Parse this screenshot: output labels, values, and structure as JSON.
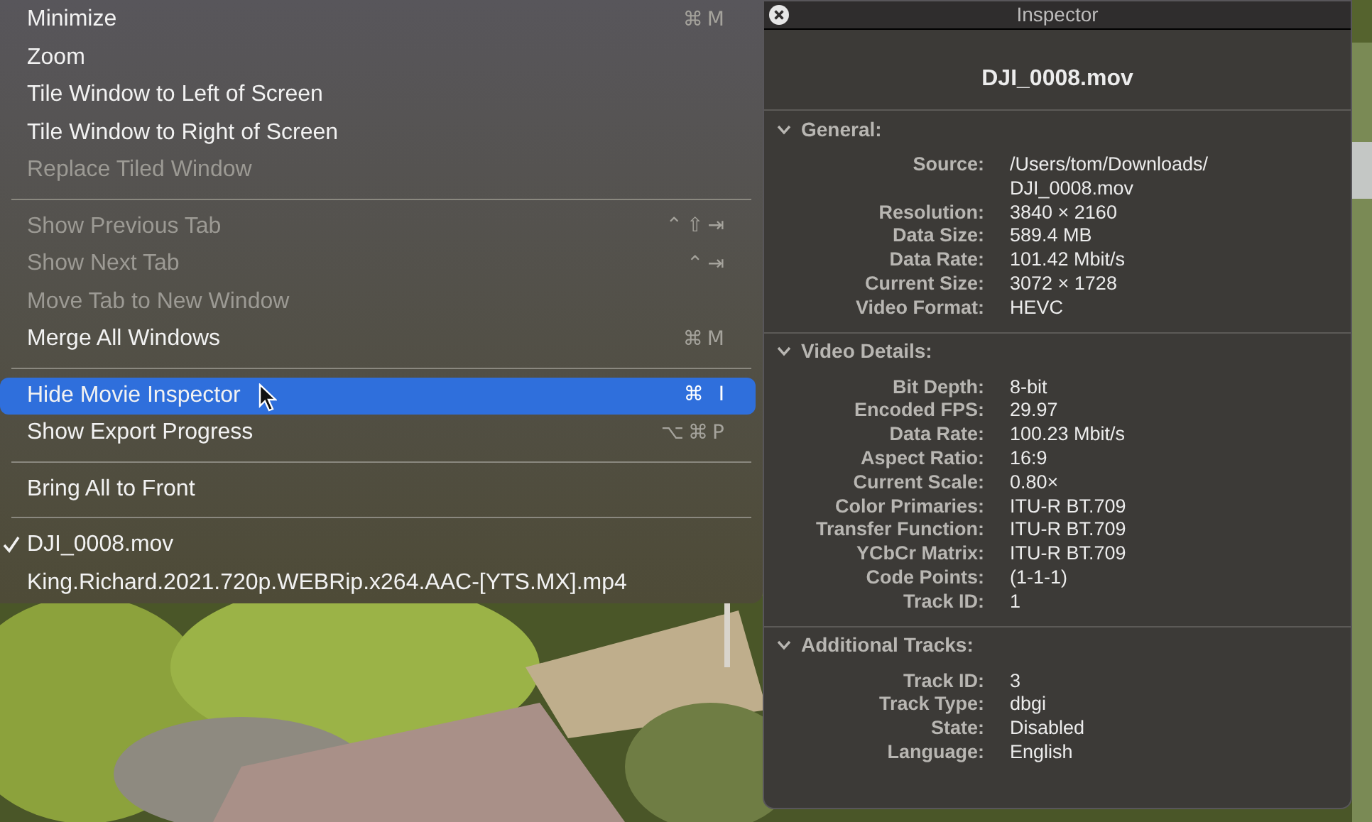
{
  "menu": {
    "sections": [
      [
        {
          "label": "Minimize",
          "shortcut": "⌘M",
          "disabled": false,
          "selected": false,
          "checked": false
        },
        {
          "label": "Zoom",
          "disabled": false,
          "selected": false,
          "checked": false
        },
        {
          "label": "Tile Window to Left of Screen",
          "disabled": false,
          "selected": false,
          "checked": false
        },
        {
          "label": "Tile Window to Right of Screen",
          "disabled": false,
          "selected": false,
          "checked": false
        },
        {
          "label": "Replace Tiled Window",
          "disabled": true,
          "selected": false,
          "checked": false
        }
      ],
      [
        {
          "label": "Show Previous Tab",
          "shortcut": "⌃⇧⇥",
          "disabled": true,
          "selected": false,
          "checked": false
        },
        {
          "label": "Show Next Tab",
          "shortcut": "⌃⇥",
          "disabled": true,
          "selected": false,
          "checked": false
        },
        {
          "label": "Move Tab to New Window",
          "disabled": true,
          "selected": false,
          "checked": false
        },
        {
          "label": "Merge All Windows",
          "shortcut": "⌘M",
          "disabled": false,
          "selected": false,
          "checked": false
        }
      ],
      [
        {
          "label": "Hide Movie Inspector",
          "shortcut": "⌘ I",
          "disabled": false,
          "selected": true,
          "checked": false
        },
        {
          "label": "Show Export Progress",
          "shortcut": "⌥⌘P",
          "disabled": false,
          "selected": false,
          "checked": false
        }
      ],
      [
        {
          "label": "Bring All to Front",
          "disabled": false,
          "selected": false,
          "checked": false
        }
      ],
      [
        {
          "label": "DJI_0008.mov",
          "disabled": false,
          "selected": false,
          "checked": true
        },
        {
          "label": "King.Richard.2021.720p.WEBRip.x264.AAC-[YTS.MX].mp4",
          "disabled": false,
          "selected": false,
          "checked": false
        }
      ]
    ]
  },
  "inspector": {
    "title": "Inspector",
    "file_name": "DJI_0008.mov",
    "sections": [
      {
        "title": "General:",
        "expanded": true,
        "rows": [
          {
            "label": "Source:",
            "value": [
              "/Users/tom/Downloads/",
              "DJI_0008.mov"
            ]
          },
          {
            "label": "Resolution:",
            "value": [
              "3840 × 2160"
            ]
          },
          {
            "label": "Data Size:",
            "value": [
              "589.4 MB"
            ]
          },
          {
            "label": "Data Rate:",
            "value": [
              "101.42 Mbit/s"
            ]
          },
          {
            "label": "Current Size:",
            "value": [
              "3072 × 1728"
            ]
          },
          {
            "label": "Video Format:",
            "value": [
              "HEVC"
            ]
          }
        ]
      },
      {
        "title": "Video Details:",
        "expanded": true,
        "rows": [
          {
            "label": "Bit Depth:",
            "value": [
              "8-bit"
            ]
          },
          {
            "label": "Encoded FPS:",
            "value": [
              "29.97"
            ]
          },
          {
            "label": "Data Rate:",
            "value": [
              "100.23 Mbit/s"
            ]
          },
          {
            "label": "Aspect Ratio:",
            "value": [
              "16:9"
            ]
          },
          {
            "label": "Current Scale:",
            "value": [
              "0.80×"
            ]
          },
          {
            "label": "Color Primaries:",
            "value": [
              "ITU-R BT.709"
            ]
          },
          {
            "label": "Transfer Function:",
            "value": [
              "ITU-R BT.709"
            ]
          },
          {
            "label": "YCbCr Matrix:",
            "value": [
              "ITU-R BT.709"
            ]
          },
          {
            "label": "Code Points:",
            "value": [
              "(1-1-1)"
            ]
          },
          {
            "label": "Track ID:",
            "value": [
              "1"
            ]
          }
        ]
      },
      {
        "title": "Additional Tracks:",
        "expanded": true,
        "rows": [
          {
            "label": "Track ID:",
            "value": [
              "3"
            ]
          },
          {
            "label": "Track Type:",
            "value": [
              "dbgi"
            ]
          },
          {
            "label": "State:",
            "value": [
              "Disabled"
            ]
          },
          {
            "label": "Language:",
            "value": [
              "English"
            ]
          }
        ]
      }
    ]
  }
}
